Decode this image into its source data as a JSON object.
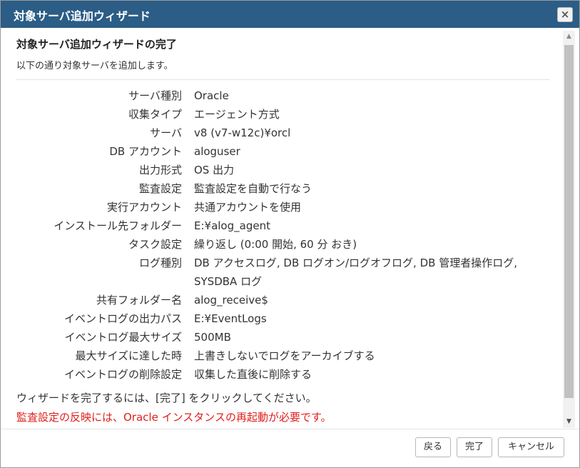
{
  "dialog": {
    "title": "対象サーバ追加ウィザード",
    "close_icon": "×"
  },
  "summary": {
    "heading": "対象サーバ追加ウィザードの完了",
    "intro": "以下の通り対象サーバを追加します。",
    "rows": [
      {
        "label": "サーバ種別",
        "value": "Oracle"
      },
      {
        "label": "収集タイプ",
        "value": "エージェント方式"
      },
      {
        "label": "サーバ",
        "value": "v8 (v7-w12c)¥orcl"
      },
      {
        "label": "DB アカウント",
        "value": "aloguser"
      },
      {
        "label": "出力形式",
        "value": "OS 出力"
      },
      {
        "label": "監査設定",
        "value": "監査設定を自動で行なう"
      },
      {
        "label": "実行アカウント",
        "value": "共通アカウントを使用"
      },
      {
        "label": "インストール先フォルダー",
        "value": "E:¥alog_agent"
      },
      {
        "label": "タスク設定",
        "value": "繰り返し (0:00 開始, 60 分 おき)"
      },
      {
        "label": "ログ種別",
        "value": "DB アクセスログ, DB ログオン/ログオフログ, DB 管理者操作ログ, SYSDBA ログ"
      },
      {
        "label": "共有フォルダー名",
        "value": "alog_receive$"
      },
      {
        "label": "イベントログの出力パス",
        "value": "E:¥EventLogs"
      },
      {
        "label": "イベントログ最大サイズ",
        "value": "500MB"
      },
      {
        "label": "最大サイズに達した時",
        "value": "上書きしないでログをアーカイブする"
      },
      {
        "label": "イベントログの削除設定",
        "value": "収集した直後に削除する"
      }
    ],
    "footnote": "ウィザードを完了するには、[完了] をクリックしてください。",
    "warning": "監査設定の反映には、Oracle インスタンスの再起動が必要です。"
  },
  "scrollbar": {
    "up_icon": "▲",
    "down_icon": "▼"
  },
  "footer": {
    "back_label": "戻る",
    "done_label": "完了",
    "cancel_label": "キャンセル"
  },
  "colors": {
    "titlebar": "#2b5d86",
    "warning_text": "#e0201c"
  }
}
